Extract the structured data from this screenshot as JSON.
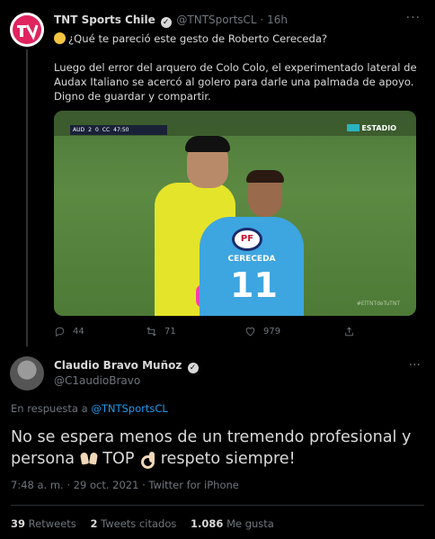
{
  "tweet1": {
    "name": "TNT Sports Chile",
    "handle": "@TNTSportsCL",
    "time": "16h",
    "line1": "¿Qué te pareció este gesto de Roberto Cereceda?",
    "body": "Luego del error del arquero de Colo Colo, el experimentado lateral de Audax Italiano se acercó al golero para darle una palmada de apoyo. Digno de guardar y compartir.",
    "media": {
      "scorebug": [
        "AUD",
        "2",
        "0",
        "CC",
        "47:50"
      ],
      "broadcaster": "ESTADIO",
      "watermark": "#ElTNTdeTuTNT",
      "shirt_sponsor": "PF",
      "shirt_name": "CERECEDA",
      "shirt_number": "11"
    },
    "actions": {
      "replies": "44",
      "retweets": "71",
      "likes": "979"
    }
  },
  "tweet2": {
    "name": "Claudio Bravo Muñoz",
    "handle": "@C1audioBravo",
    "reply_prefix": "En respuesta a",
    "reply_handle": "@TNTSportsCL",
    "text_part1": "No se espera menos de un tremendo profesional y persona",
    "text_part2": "TOP",
    "text_part3": "respeto siempre!",
    "time": "7:48 a. m.",
    "date": "29 oct. 2021",
    "source": "Twitter for iPhone",
    "stats": {
      "retweets": "39",
      "retweets_label": "Retweets",
      "quotes": "2",
      "quotes_label": "Tweets citados",
      "likes": "1.086",
      "likes_label": "Me gusta"
    }
  },
  "colors": {
    "background": "#000000",
    "accent": "#1d9bf0",
    "text": "#d9d9d9",
    "muted": "#6e767d"
  }
}
